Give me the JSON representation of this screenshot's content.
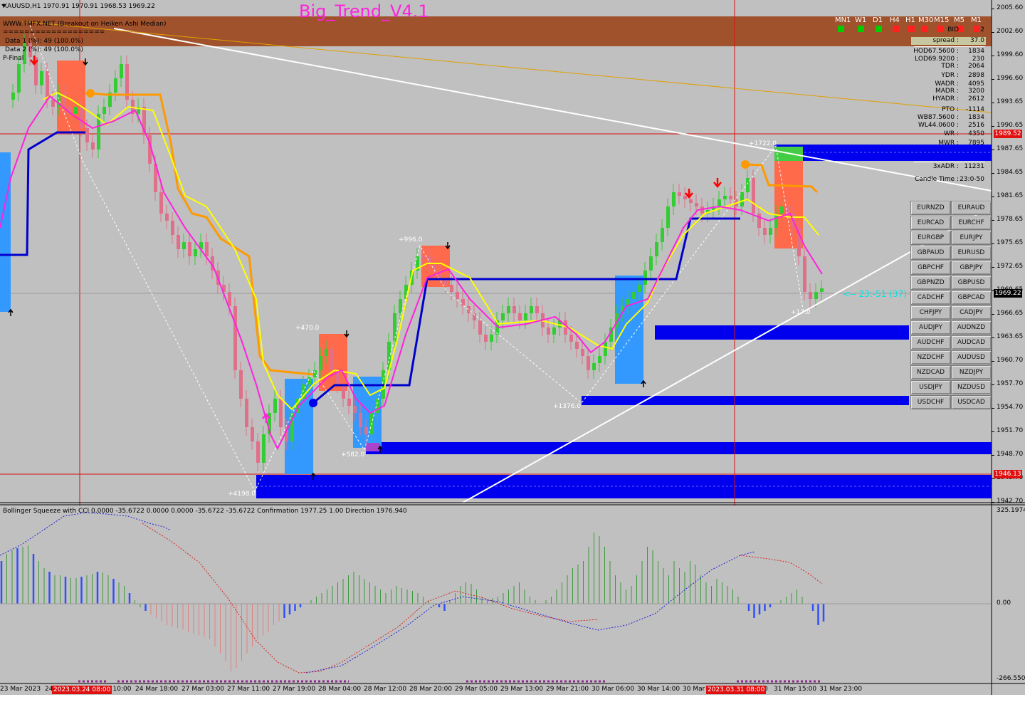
{
  "header": {
    "symbol_line": "XAUUSD,H1  1970.91 1970.91 1968.53 1969.22",
    "indicator_title": "Big_Trend_V4.1",
    "site_line": "WWW.TMFX.NET (Breakout on Heiken Ashi Median)",
    "separator": "===================",
    "data1": "Data 1 (%): 49 (100.0%)",
    "data2": "Data 2 (%): 49 (100.0%)",
    "pfinal": "P-Final"
  },
  "timeframes": [
    {
      "label": "MN1",
      "color": "#00cc00"
    },
    {
      "label": "W1",
      "color": "#00cc00"
    },
    {
      "label": "D1",
      "color": "#00cc00"
    },
    {
      "label": "H4",
      "color": "#ff2020"
    },
    {
      "label": "H1",
      "color": "#ff2020"
    },
    {
      "label": "M30",
      "color": "#ff2020"
    },
    {
      "label": "M15",
      "color": "#ff2020"
    },
    {
      "label": "M5",
      "color": "#ff2020"
    },
    {
      "label": "M1",
      "color": "#ff2020"
    }
  ],
  "stats": [
    {
      "label": "BID",
      "value": "2"
    },
    {
      "label": "spread :",
      "value": "37.0"
    },
    {
      "label": "HOD",
      "sub": "67.5600 :",
      "value": "1834"
    },
    {
      "label": "LOD",
      "sub": "69.9200 :",
      "value": "230"
    },
    {
      "label": "TDR :",
      "value": "2064"
    },
    {
      "label": "YDR :",
      "value": "2898"
    },
    {
      "label": "WADR :",
      "value": "4095"
    },
    {
      "label": "MADR :",
      "value": "3200"
    },
    {
      "label": "HYADR :",
      "value": "2612"
    },
    {
      "label": "PTO :",
      "value": "-1114"
    },
    {
      "label": "WB",
      "sub": "87.5600 :",
      "value": "1834"
    },
    {
      "label": "WL",
      "sub": "44.0600 :",
      "value": "2516"
    },
    {
      "label": "WR :",
      "value": "4350"
    },
    {
      "label": "MWR :",
      "value": "7895"
    },
    {
      "label": "3xADR :",
      "value": "11231"
    },
    {
      "label": "Candle Time :",
      "value": "23:0-50"
    }
  ],
  "pairs": [
    [
      "EURNZD",
      "EURAUD"
    ],
    [
      "EURCAD",
      "EURCHF"
    ],
    [
      "EURGBP",
      "EURJPY"
    ],
    [
      "GBPAUD",
      "EURUSD"
    ],
    [
      "GBPCHF",
      "GBPJPY"
    ],
    [
      "GBPNZD",
      "GBPUSD"
    ],
    [
      "CADCHF",
      "GBPCAD"
    ],
    [
      "CHFJPY",
      "CADJPY"
    ],
    [
      "AUDJPY",
      "AUDNZD"
    ],
    [
      "AUDCHF",
      "AUDCAD"
    ],
    [
      "NZDCHF",
      "AUDUSD"
    ],
    [
      "NZDCAD",
      "NZDJPY"
    ],
    [
      "USDJPY",
      "NZDUSD"
    ],
    [
      "USDCHF",
      "USDCAD"
    ]
  ],
  "price_axis": [
    "2005.60",
    "2002.60",
    "1999.60",
    "1996.60",
    "1993.65",
    "1990.65",
    "1987.65",
    "1984.65",
    "1981.65",
    "1978.65",
    "1975.65",
    "1972.65",
    "1969.65",
    "1966.65",
    "1963.65",
    "1960.70",
    "1957.70",
    "1954.70",
    "1951.70",
    "1948.70",
    "1945.70",
    "1942.70"
  ],
  "price_boxes": {
    "upper": "1989.52",
    "current": "1969.22",
    "lower": "1946.13"
  },
  "countdown": "<-- 23:-51 (37)",
  "chart_labels": {
    "l1": "+4198.0",
    "l2": "+470.0",
    "l3": "+582.0",
    "l4": "+996.0",
    "l5": "+1376.0",
    "l6": "+1722.0",
    "l7": "+17.0"
  },
  "subwindow": {
    "title": "Bollinger Squeeze with CCI 0.0000 -35.6722 0.0000 0.0000 -35.6722 -35.6722  Confirmation 1977.25 1.00  Direction 1976.940",
    "top": "325.1974",
    "zero": "0.00",
    "bottom": "-266.5505"
  },
  "time_axis": [
    "23 Mar 2023",
    "24",
    "r 10:00",
    "24 Mar 18:00",
    "27 Mar 03:00",
    "27 Mar 11:00",
    "27 Mar 19:00",
    "28 Mar 04:00",
    "28 Mar 12:00",
    "28 Mar 20:00",
    "29 Mar 05:00",
    "29 Mar 13:00",
    "29 Mar 21:00",
    "30 Mar 06:00",
    "30 Mar 14:00",
    "30 Mar",
    "0",
    "31 Mar 15:00",
    "31 Mar 23:00"
  ],
  "time_boxes": [
    "2023.03.24 08:00",
    "2023.03.31 08:00"
  ],
  "colors": {
    "bg": "#c0c0c0",
    "bull": "#33cc33",
    "bear": "#e0708a",
    "magenta": "#ff22dd",
    "yellow": "#ffff00",
    "orange": "#ff9900",
    "blue": "#0000ee",
    "red_line": "#dd1111"
  }
}
